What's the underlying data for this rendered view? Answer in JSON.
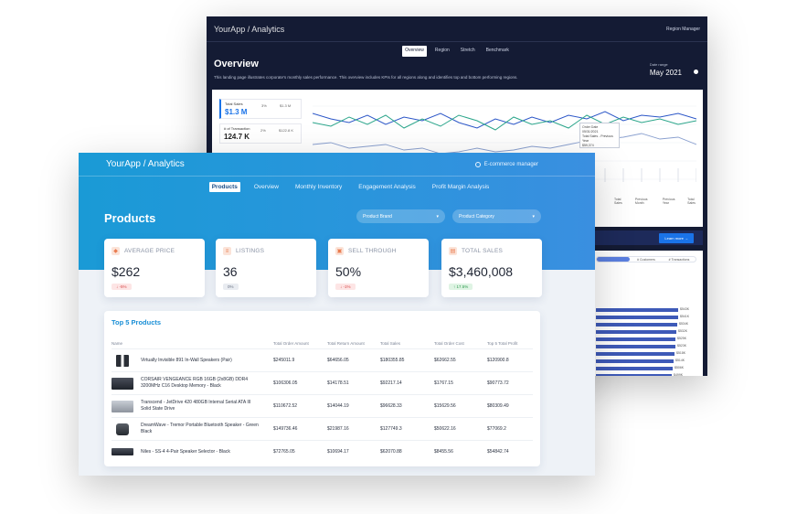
{
  "back_window": {
    "brand": "YourApp",
    "brand_section": "/ Analytics",
    "user": "Region Manager",
    "tabs": [
      {
        "label": "Overview",
        "active": true
      },
      {
        "label": "Region",
        "active": false
      },
      {
        "label": "Stretch",
        "active": false
      },
      {
        "label": "Benchmark",
        "active": false
      }
    ],
    "title": "Overview",
    "description": "This landing page illustrates corporate's monthly sales performance. This overview includes KPIs for all regions along and identifies top and bottom performing regions.",
    "date_label": "Date range",
    "date_value": "May 2021",
    "kpis": [
      {
        "label": "Total Sales",
        "value": "$1.3 M",
        "p1": "3%",
        "p2": "$1.3 M"
      },
      {
        "label": "# of Transaction",
        "value": "124.7 K",
        "p1": "2%",
        "p2": "$122.8 K"
      }
    ],
    "tooltip": {
      "line1": "Order Date",
      "line2": "05/31/2021",
      "line3": "Total Sales - Previous Year",
      "line4": "$59,374"
    },
    "legend": [
      "Total Sales",
      "Previous Month",
      "Previous Year",
      "Total Sales"
    ],
    "learn_more": "Learn more →",
    "segments": [
      "",
      "# Customers",
      "# Transactions"
    ],
    "bar_labels": [
      "$543K",
      "$541K",
      "$534K",
      "$532K",
      "$525K",
      "$523K",
      "$518K",
      "$514K",
      "$506K",
      "$499K",
      "$492K",
      "$486K"
    ],
    "bar_values": [
      543,
      541,
      534,
      532,
      525,
      523,
      518,
      514,
      506,
      499,
      492,
      486
    ],
    "line_series_colors": [
      "#2a55c7",
      "#2aa58a",
      "#8aa0cf"
    ]
  },
  "front_window": {
    "brand": "YourApp",
    "brand_section": "/ Analytics",
    "user": "E-commerce manager",
    "nav": [
      {
        "label": "Products",
        "active": true
      },
      {
        "label": "Overview",
        "active": false
      },
      {
        "label": "Monthly Inventory",
        "active": false
      },
      {
        "label": "Engagement Analysis",
        "active": false
      },
      {
        "label": "Profit Margin Analysis",
        "active": false
      }
    ],
    "title": "Products",
    "dropdowns": [
      {
        "label": "Product Brand"
      },
      {
        "label": "Product Category"
      }
    ],
    "kpis": [
      {
        "label": "AVERAGE PRICE",
        "value": "$262",
        "badge": "↓ -5%",
        "trend": "down",
        "icon": "tag-icon"
      },
      {
        "label": "LISTINGS",
        "value": "36",
        "badge": "0%",
        "trend": "flat",
        "icon": "list-icon"
      },
      {
        "label": "SELL THROUGH",
        "value": "50%",
        "badge": "↓ -1%",
        "trend": "down",
        "icon": "cart-icon"
      },
      {
        "label": "TOTAL SALES",
        "value": "$3,460,008",
        "badge": "↑ 17.5%",
        "trend": "up",
        "icon": "bar-chart-icon"
      }
    ],
    "table": {
      "title": "Top 5 Products",
      "columns": [
        "Name",
        "Total Order Amount",
        "Total Return Amount",
        "Total Sales",
        "Total Order Cost",
        "Top 5 Total Profit"
      ],
      "rows": [
        {
          "name": "Virtually Invisible 891 In-Wall Speakers (Pair)",
          "oa": "$245011.9",
          "ra": "$64656.05",
          "ts": "$180355.85",
          "oc": "$62662.55",
          "tp": "$120900.8",
          "thumb": "speakers"
        },
        {
          "name": "CORSAIR VENGEANCE RGB 16GB (2x8GB) DDR4 3200MHz C16 Desktop Memory - Black",
          "oa": "$106306.05",
          "ra": "$14178.51",
          "ts": "$92217.14",
          "oc": "$1767.15",
          "tp": "$90773.72",
          "thumb": "memory"
        },
        {
          "name": "Transcend - JetDrive 420 480GB Internal Serial ATA III Solid State Drive",
          "oa": "$110672.52",
          "ra": "$14044.19",
          "ts": "$96628.33",
          "oc": "$15629.56",
          "tp": "$80309.49",
          "thumb": "ssd"
        },
        {
          "name": "DreamWave - Tremor Portable Bluetooth Speaker - Green Black",
          "oa": "$149736.46",
          "ra": "$21987.16",
          "ts": "$127749.3",
          "oc": "$50622.16",
          "tp": "$77069.2",
          "thumb": "speaker"
        },
        {
          "name": "Niles - SS-4 4-Pair Speaker Selector - Black",
          "oa": "$72765.05",
          "ra": "$10694.17",
          "ts": "$62070.88",
          "oc": "$8455.56",
          "tp": "$54842.74",
          "thumb": "selector"
        }
      ]
    }
  }
}
